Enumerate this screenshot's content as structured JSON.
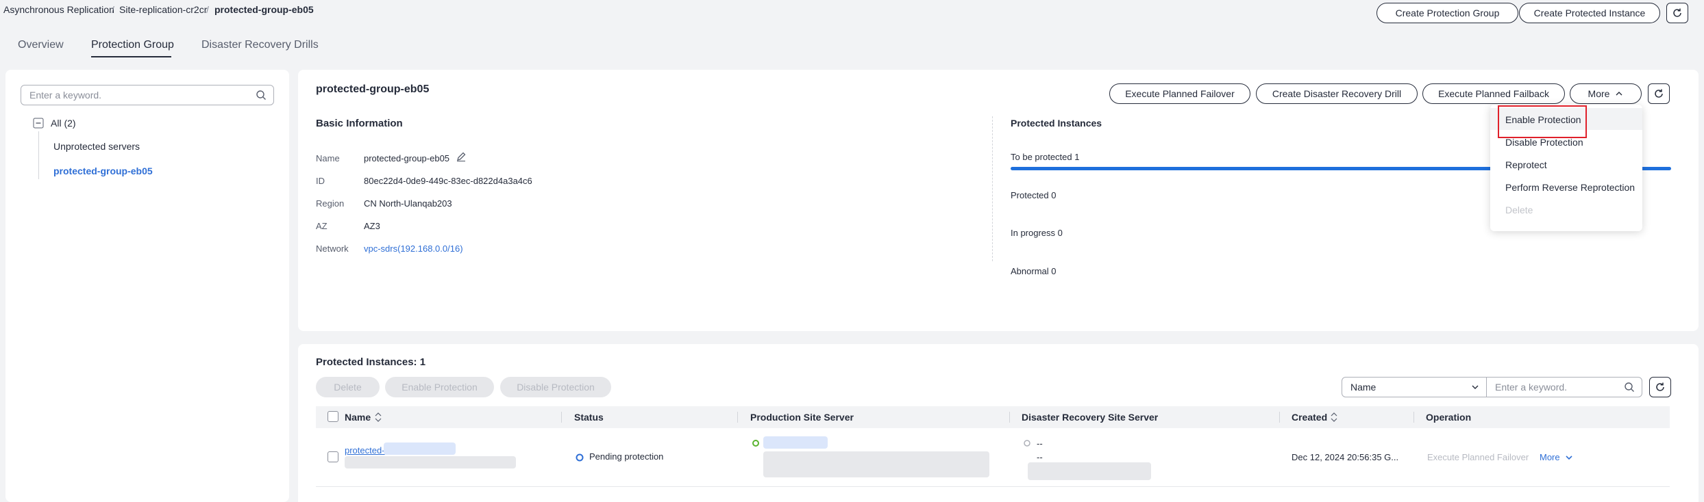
{
  "breadcrumb": [
    "Asynchronous Replication",
    "Site-replication-cr2cr",
    "protected-group-eb05"
  ],
  "breadcrumb_sep": "/",
  "header_actions": {
    "create_group": "Create Protection Group",
    "create_instance": "Create Protected Instance"
  },
  "tabs": [
    {
      "label": "Overview",
      "active": false
    },
    {
      "label": "Protection Group",
      "active": true
    },
    {
      "label": "Disaster Recovery Drills",
      "active": false
    }
  ],
  "sidebar": {
    "search_placeholder": "Enter a keyword.",
    "tree_root": "All (2)",
    "items": [
      {
        "label": "Unprotected servers",
        "selected": false
      },
      {
        "label": "protected-group-eb05",
        "selected": true
      }
    ]
  },
  "detail": {
    "title": "protected-group-eb05",
    "actions": {
      "failover": "Execute Planned Failover",
      "drill": "Create Disaster Recovery Drill",
      "failback": "Execute Planned Failback",
      "more": "More"
    },
    "basic_info_title": "Basic Information",
    "fields": [
      {
        "label": "Name",
        "value": "protected-group-eb05"
      },
      {
        "label": "ID",
        "value": "80ec22d4-0de9-449c-83ec-d822d4a3a4c6"
      },
      {
        "label": "Region",
        "value": "CN North-Ulanqab203"
      },
      {
        "label": "AZ",
        "value": "AZ3"
      },
      {
        "label": "Network",
        "value": "vpc-sdrs(192.168.0.0/16)"
      }
    ],
    "protected_instances_title": "Protected Instances",
    "stats": {
      "to_be_protected": "To be protected 1",
      "protected": "Protected 0",
      "in_progress": "In progress 0",
      "abnormal": "Abnormal 0"
    },
    "to_be_protected_fraction": 1.0
  },
  "more_menu": {
    "items": [
      {
        "label": "Enable Protection",
        "highlighted": true,
        "disabled": false
      },
      {
        "label": "Disable Protection",
        "highlighted": false,
        "disabled": false
      },
      {
        "label": "Reprotect",
        "highlighted": false,
        "disabled": false
      },
      {
        "label": "Perform Reverse Reprotection",
        "highlighted": false,
        "disabled": false
      },
      {
        "label": "Delete",
        "highlighted": false,
        "disabled": true
      }
    ]
  },
  "instances": {
    "title": "Protected Instances: 1",
    "toolbar": {
      "delete": "Delete",
      "enable": "Enable Protection",
      "disable": "Disable Protection"
    },
    "filter_select": "Name",
    "filter_placeholder": "Enter a keyword.",
    "columns": [
      "Name",
      "Status",
      "Production Site Server",
      "Disaster Recovery Site Server",
      "Created",
      "Operation"
    ],
    "rows": [
      {
        "name_visible": "protected-",
        "status": "Pending protection",
        "dr_server_line1": "--",
        "dr_server_line2": "--",
        "created": "Dec 12, 2024 20:56:35 G...",
        "op_failover": "Execute Planned Failover",
        "op_more": "More"
      }
    ]
  },
  "colors": {
    "accent_link": "#2f6fd6",
    "progress": "#1e6fdc",
    "highlight_box": "#e0202a",
    "status_pending": "#2f6fd6",
    "server_running": "#5ab430"
  },
  "icons": {
    "refresh": "refresh-icon",
    "search": "search-icon",
    "edit": "edit-icon",
    "sort": "sort-icon",
    "chevron": "chevron-down-icon",
    "collapse": "collapse-icon"
  }
}
